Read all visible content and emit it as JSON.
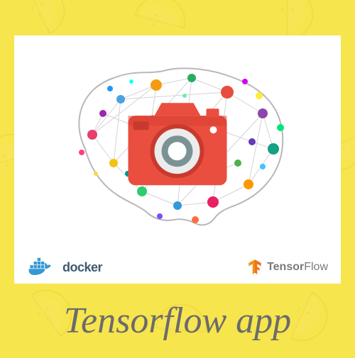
{
  "title": "Tensorflow app",
  "logos": {
    "docker": {
      "text": "docker"
    },
    "tensorflow": {
      "prefix": "Tensor",
      "suffix": "Flow"
    }
  },
  "colors": {
    "background": "#f7e54d",
    "card": "#ffffff",
    "camera": "#e94e3f",
    "docker": "#3598d4",
    "tensorflow": "#f39019",
    "title": "#6b6b6b"
  }
}
